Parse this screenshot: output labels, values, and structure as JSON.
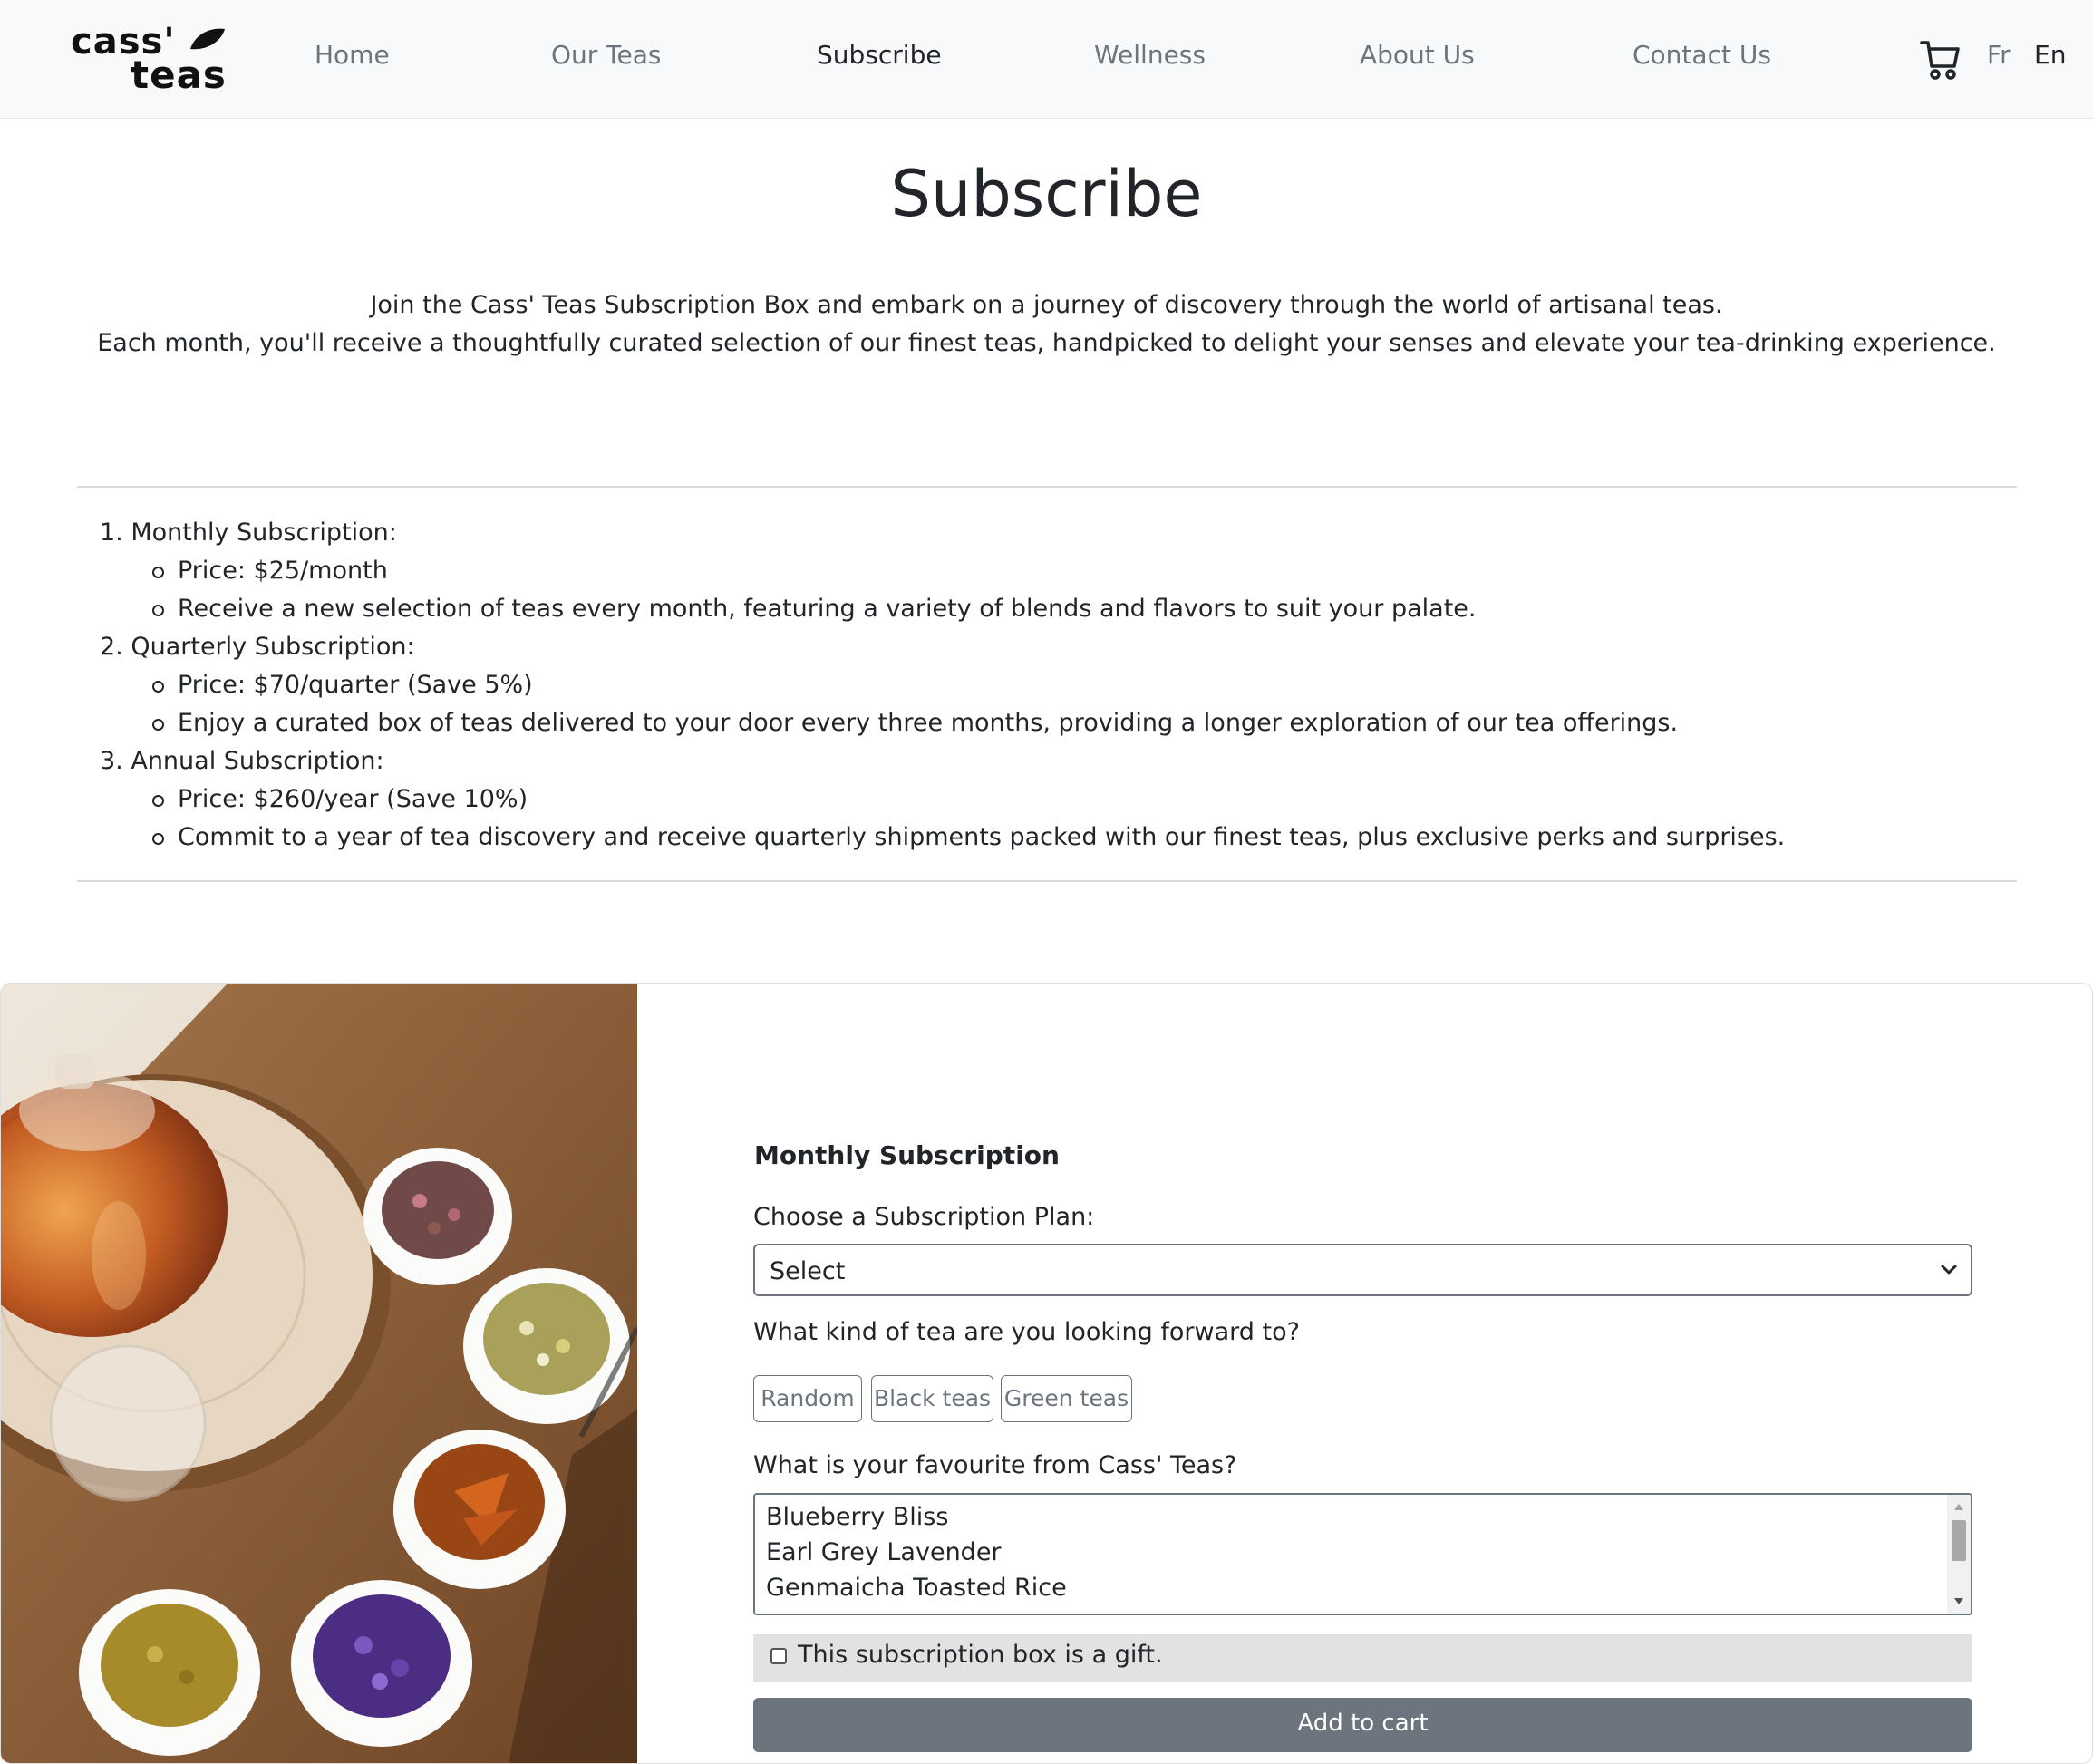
{
  "brand": {
    "logo_line1": "cass'",
    "logo_line2": "teas"
  },
  "nav": {
    "items": [
      {
        "label": "Home"
      },
      {
        "label": "Our Teas"
      },
      {
        "label": "Subscribe"
      },
      {
        "label": "Wellness"
      },
      {
        "label": "About Us"
      },
      {
        "label": "Contact Us"
      }
    ],
    "active": "Subscribe",
    "lang_fr": "Fr",
    "lang_en": "En",
    "active_lang": "En"
  },
  "hero": {
    "title": "Subscribe",
    "intro_line1": "Join the Cass' Teas Subscription Box and embark on a journey of discovery through the world of artisanal teas.",
    "intro_line2": "Each month, you'll receive a thoughtfully curated selection of our finest teas, handpicked to delight your senses and elevate your tea-drinking experience."
  },
  "plans": [
    {
      "title": "1. Monthly Subscription:",
      "items": [
        "Price: $25/month",
        "Receive a new selection of teas every month, featuring a variety of blends and flavors to suit your palate."
      ]
    },
    {
      "title": "2. Quarterly Subscription:",
      "items": [
        "Price: $70/quarter (Save 5%)",
        "Enjoy a curated box of teas delivered to your door every three months, providing a longer exploration of our tea offerings."
      ]
    },
    {
      "title": "3. Annual Subscription:",
      "items": [
        "Price: $260/year (Save 10%)",
        "Commit to a year of tea discovery and receive quarterly shipments packed with our finest teas, plus exclusive perks and surprises."
      ]
    }
  ],
  "form": {
    "title": "Monthly Subscription",
    "plan_label": "Choose a Subscription Plan:",
    "plan_value": "Select",
    "tea_kind_label": "What kind of tea are you looking forward to?",
    "tea_kinds": [
      "Random",
      "Black teas",
      "Green teas"
    ],
    "favourite_label": "What is your favourite from Cass' Teas?",
    "favourites": [
      "Blueberry Bliss",
      "Earl Grey Lavender",
      "Genmaicha Toasted Rice"
    ],
    "gift_label": "This subscription box is a gift.",
    "gift_checked": false,
    "add_to_cart": "Add to cart"
  },
  "colors": {
    "navbar_bg": "#f8f9fa",
    "nav_inactive": "#6c757d",
    "text": "#212529",
    "button_secondary": "#6c757d",
    "gift_row_bg": "#e2e2e2"
  },
  "icons": {
    "cart": "cart-icon",
    "leaf": "leaf-icon",
    "chevron": "chevron-down-icon"
  }
}
